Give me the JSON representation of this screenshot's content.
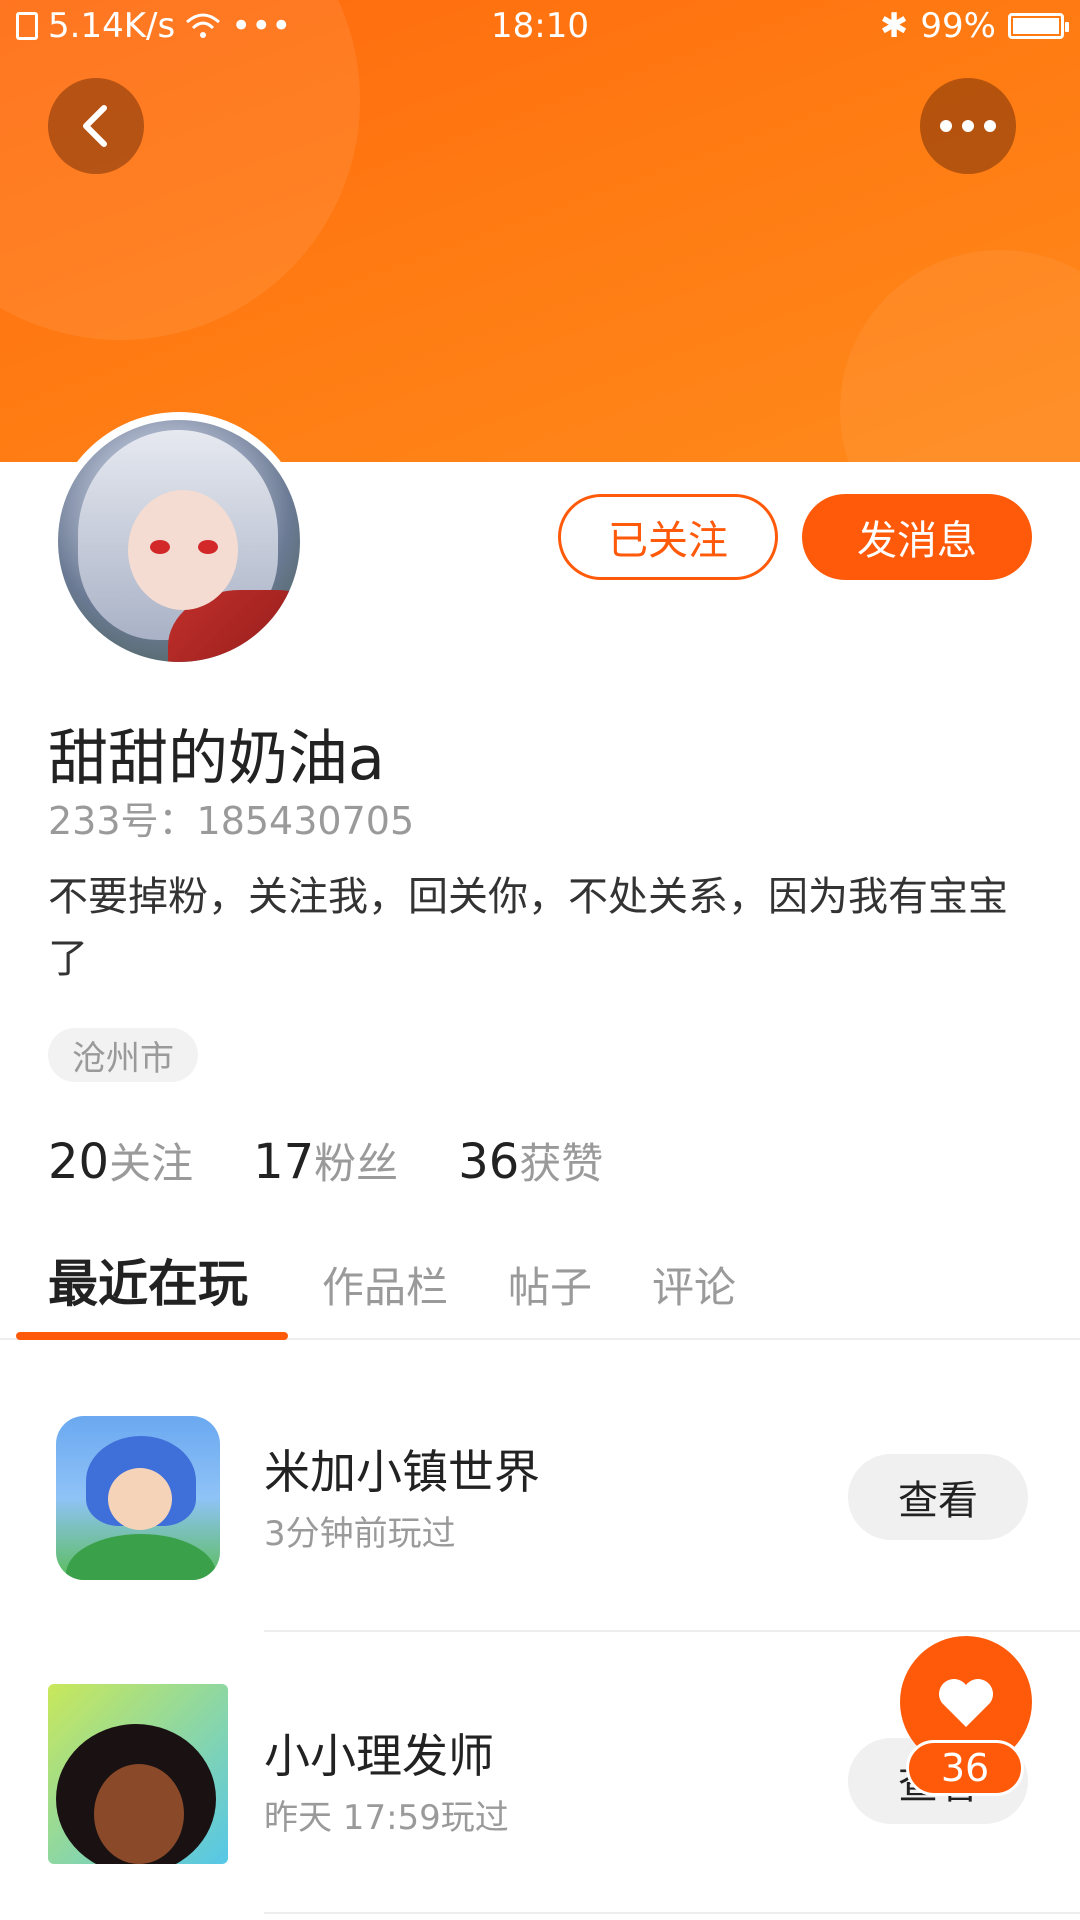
{
  "status_bar": {
    "net_speed": "5.14K/s",
    "dots": "•••",
    "time": "18:10",
    "bluetooth": "✱",
    "battery_text": "99%",
    "battery_level": 0.99
  },
  "header": {
    "back_icon": "chevron-left-icon",
    "more_icon": "more-horizontal-icon",
    "brand_color": "#ff6a0f"
  },
  "profile": {
    "followed_label": "已关注",
    "message_label": "发消息",
    "nickname": "甜甜的奶油a",
    "account_id": "233号：185430705",
    "bio": "不要掉粉，关注我，回关你，不处关系，因为我有宝宝了",
    "location": "沧州市",
    "stats": [
      {
        "num": "20",
        "label": "关注"
      },
      {
        "num": "17",
        "label": "粉丝"
      },
      {
        "num": "36",
        "label": "获赞"
      }
    ]
  },
  "tabs": [
    {
      "label": "最近在玩",
      "active": true
    },
    {
      "label": "作品栏",
      "active": false
    },
    {
      "label": "帖子",
      "active": false
    },
    {
      "label": "评论",
      "active": false
    }
  ],
  "games": [
    {
      "title": "米加小镇世界",
      "subtitle": "3分钟前玩过",
      "action": "查看"
    },
    {
      "title": "小小理发师",
      "subtitle": "昨天 17:59玩过",
      "action": "查看"
    }
  ],
  "like_badge": {
    "count": "36"
  },
  "accent_color": "#ff5a0a"
}
